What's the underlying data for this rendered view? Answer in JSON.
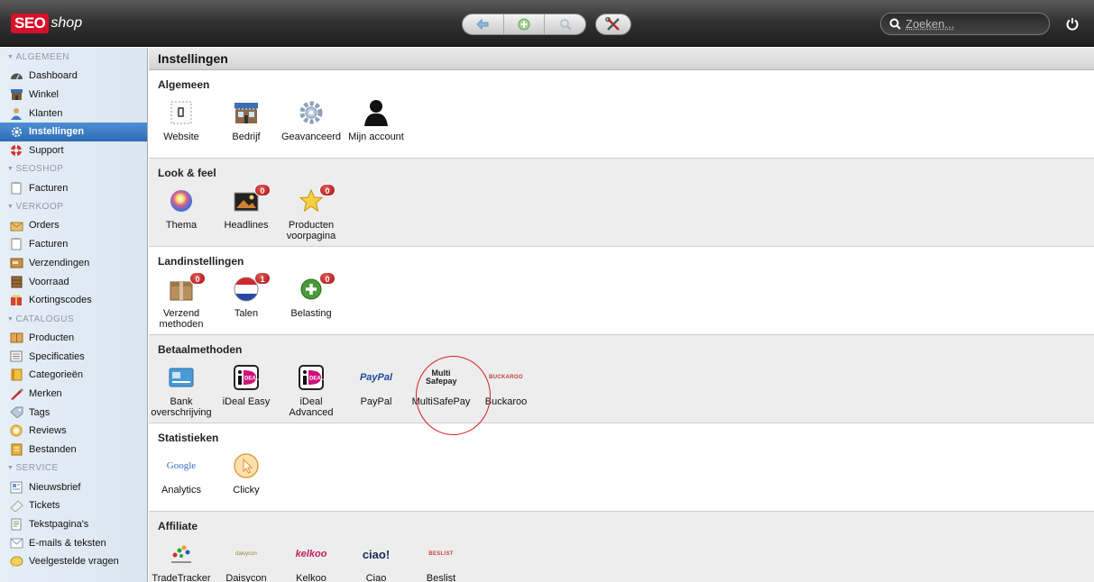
{
  "brand": {
    "logo_red": "SEO",
    "logo_white": "shop"
  },
  "search": {
    "placeholder": "Zoeken..."
  },
  "sidebar": {
    "sections": [
      {
        "title": "ALGEMEEN",
        "items": [
          {
            "label": "Dashboard",
            "icon": "dashboard-icon"
          },
          {
            "label": "Winkel",
            "icon": "store-icon"
          },
          {
            "label": "Klanten",
            "icon": "customers-icon"
          },
          {
            "label": "Instellingen",
            "icon": "gear-icon",
            "active": true
          },
          {
            "label": "Support",
            "icon": "lifebuoy-icon"
          }
        ]
      },
      {
        "title": "SEOSHOP",
        "items": [
          {
            "label": "Facturen",
            "icon": "invoice-icon"
          }
        ]
      },
      {
        "title": "VERKOOP",
        "items": [
          {
            "label": "Orders",
            "icon": "orders-icon"
          },
          {
            "label": "Facturen",
            "icon": "invoice-icon"
          },
          {
            "label": "Verzendingen",
            "icon": "shipping-icon"
          },
          {
            "label": "Voorraad",
            "icon": "stock-icon"
          },
          {
            "label": "Kortingscodes",
            "icon": "gift-icon"
          }
        ]
      },
      {
        "title": "CATALOGUS",
        "items": [
          {
            "label": "Producten",
            "icon": "products-icon"
          },
          {
            "label": "Specificaties",
            "icon": "specs-icon"
          },
          {
            "label": "Categorieën",
            "icon": "categories-icon"
          },
          {
            "label": "Merken",
            "icon": "brand-icon"
          },
          {
            "label": "Tags",
            "icon": "tag-icon"
          },
          {
            "label": "Reviews",
            "icon": "reviews-icon"
          },
          {
            "label": "Bestanden",
            "icon": "files-icon"
          }
        ]
      },
      {
        "title": "SERVICE",
        "items": [
          {
            "label": "Nieuwsbrief",
            "icon": "newsletter-icon"
          },
          {
            "label": "Tickets",
            "icon": "ticket-icon"
          },
          {
            "label": "Tekstpagina's",
            "icon": "textpage-icon"
          },
          {
            "label": "E-mails & teksten",
            "icon": "email-icon"
          },
          {
            "label": "Veelgestelde vragen",
            "icon": "faq-icon"
          }
        ]
      }
    ]
  },
  "page": {
    "title": "Instellingen"
  },
  "groups": [
    {
      "title": "Algemeen",
      "tiles": [
        {
          "label": "Website",
          "icon": "website-icon"
        },
        {
          "label": "Bedrijf",
          "icon": "company-icon"
        },
        {
          "label": "Geavanceerd",
          "icon": "advanced-gear-icon"
        },
        {
          "label": "Mijn account",
          "icon": "account-icon"
        }
      ]
    },
    {
      "title": "Look & feel",
      "tiles": [
        {
          "label": "Thema",
          "icon": "theme-icon"
        },
        {
          "label": "Headlines",
          "icon": "headlines-icon",
          "badge": "0"
        },
        {
          "label": "Producten voorpagina",
          "icon": "star-icon",
          "badge": "0"
        }
      ]
    },
    {
      "title": "Landinstellingen",
      "tiles": [
        {
          "label": "Verzend methoden",
          "icon": "box-icon",
          "badge": "0"
        },
        {
          "label": "Talen",
          "icon": "flag-icon",
          "badge": "1"
        },
        {
          "label": "Belasting",
          "icon": "tax-plus-icon",
          "badge": "0"
        }
      ]
    },
    {
      "title": "Betaalmethoden",
      "tiles": [
        {
          "label": "Bank overschrijving",
          "icon": "bank-card-icon"
        },
        {
          "label": "iDeal Easy",
          "icon": "ideal-icon"
        },
        {
          "label": "iDeal Advanced",
          "icon": "ideal-icon"
        },
        {
          "label": "PayPal",
          "icon": "paypal-logo-icon",
          "logo_text": "PayPal"
        },
        {
          "label": "MultiSafePay",
          "icon": "multisafepay-logo-icon",
          "logo_text": "Multi Safepay"
        },
        {
          "label": "Buckaroo",
          "icon": "buckaroo-logo-icon",
          "logo_text": "BUCKAROO"
        }
      ]
    },
    {
      "title": "Statistieken",
      "tiles": [
        {
          "label": "Analytics",
          "icon": "google-logo-icon",
          "logo_text": "Google"
        },
        {
          "label": "Clicky",
          "icon": "clicky-icon"
        }
      ]
    },
    {
      "title": "Affiliate",
      "tiles": [
        {
          "label": "TradeTracker",
          "icon": "tradetracker-logo-icon"
        },
        {
          "label": "Daisycon",
          "icon": "daisycon-logo-icon",
          "logo_text": "daisycon"
        },
        {
          "label": "Kelkoo",
          "icon": "kelkoo-logo-icon",
          "logo_text": "kelkoo"
        },
        {
          "label": "Ciao",
          "icon": "ciao-logo-icon",
          "logo_text": "ciao!"
        },
        {
          "label": "Beslist",
          "icon": "beslist-logo-icon",
          "logo_text": "BESLIST"
        }
      ]
    }
  ],
  "colors": {
    "active_item": "#2c6cb6",
    "badge": "#c01818",
    "annotation": "#d42020"
  }
}
